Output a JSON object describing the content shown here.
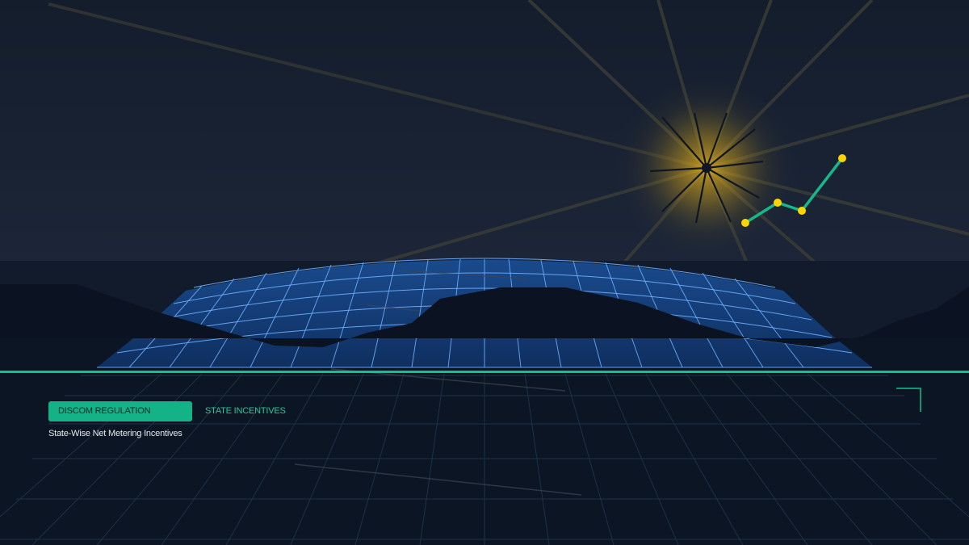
{
  "tabs": {
    "active_label": "DISCOM REGULATION",
    "inactive_label": "STATE INCENTIVES"
  },
  "subtitle": "State-Wise Net Metering Incentives",
  "colors": {
    "sky": "#1c2638",
    "ground": "#0b1524",
    "accent": "#15c08f",
    "panel": "#12356a",
    "panel_grid": "#5ea3ff",
    "sun": "#ffc21a",
    "marker": "#ffd400"
  },
  "icons": {
    "sun": "sun-icon",
    "trend_marker": "trend-marker-icon",
    "corner_bracket": "corner-bracket-icon"
  }
}
